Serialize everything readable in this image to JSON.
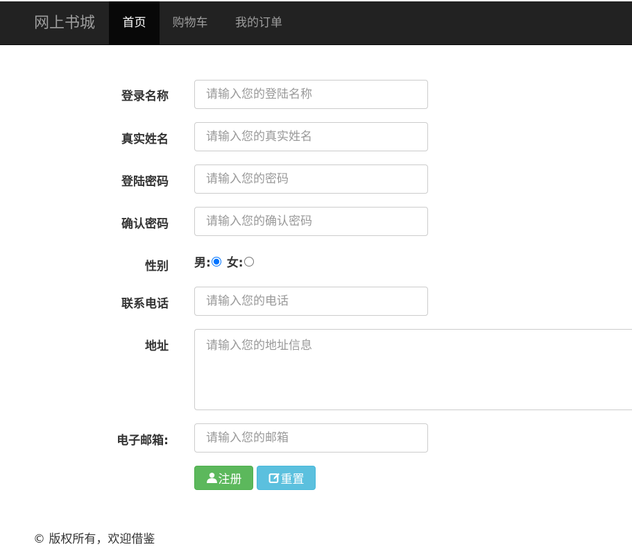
{
  "navbar": {
    "brand": "网上书城",
    "items": [
      {
        "label": "首页",
        "active": true
      },
      {
        "label": "购物车",
        "active": false
      },
      {
        "label": "我的订单",
        "active": false
      }
    ]
  },
  "form": {
    "login_name": {
      "label": "登录名称",
      "placeholder": "请输入您的登陆名称"
    },
    "real_name": {
      "label": "真实姓名",
      "placeholder": "请输入您的真实姓名"
    },
    "password": {
      "label": "登陆密码",
      "placeholder": "请输入您的密码"
    },
    "confirm_password": {
      "label": "确认密码",
      "placeholder": "请输入您的确认密码"
    },
    "gender": {
      "label": "性别",
      "male": "男:",
      "female": "女:",
      "selected": "男"
    },
    "phone": {
      "label": "联系电话",
      "placeholder": "请输入您的电话"
    },
    "address": {
      "label": "地址",
      "placeholder": "请输入您的地址信息"
    },
    "email": {
      "label": "电子邮箱:",
      "placeholder": "请输入您的邮箱"
    },
    "register_button": "注册",
    "reset_button": "重置"
  },
  "colors": {
    "navbar_bg": "#222222",
    "success": "#5cb85c",
    "info": "#5bc0de"
  },
  "footer": {
    "text": "© 版权所有，欢迎借鉴"
  }
}
